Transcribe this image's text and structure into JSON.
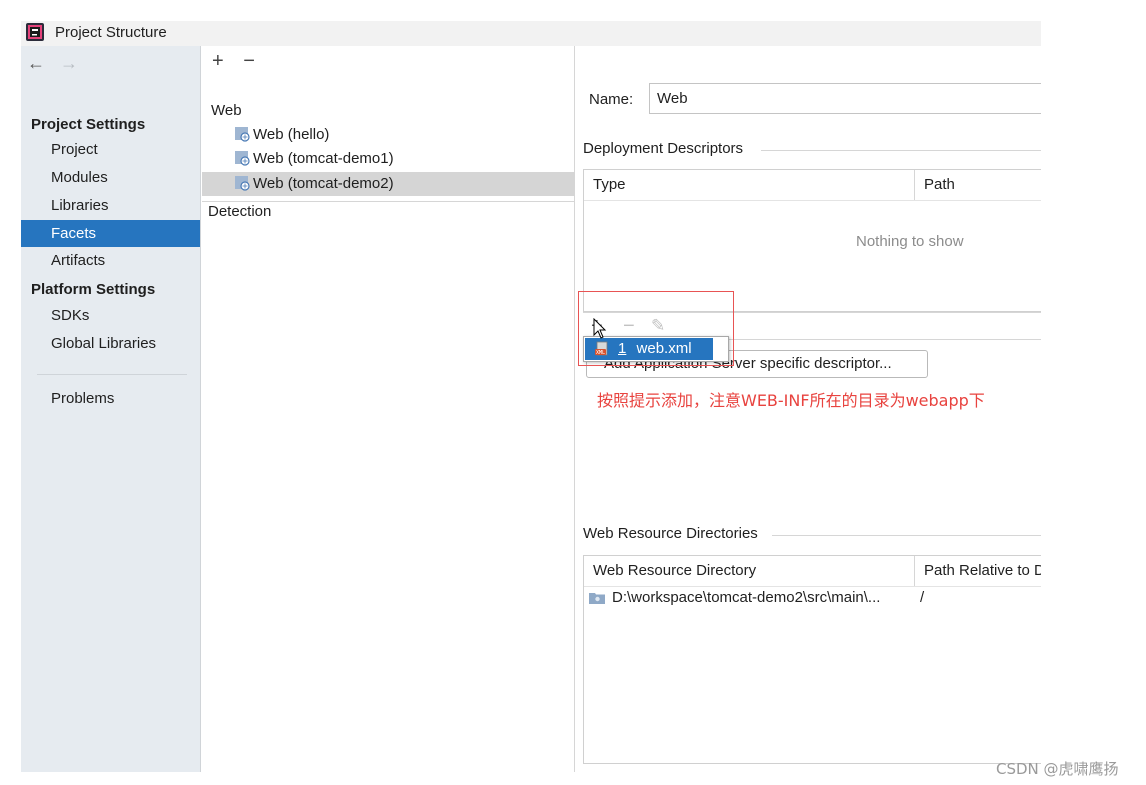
{
  "window": {
    "title": "Project Structure"
  },
  "sidebar": {
    "nav_back": "←",
    "nav_forward": "→",
    "project_settings_header": "Project Settings",
    "project_items": [
      {
        "label": "Project"
      },
      {
        "label": "Modules"
      },
      {
        "label": "Libraries"
      },
      {
        "label": "Facets",
        "selected": true
      },
      {
        "label": "Artifacts"
      }
    ],
    "platform_settings_header": "Platform Settings",
    "platform_items": [
      {
        "label": "SDKs"
      },
      {
        "label": "Global Libraries"
      }
    ],
    "problems_label": "Problems"
  },
  "facets_tree": {
    "add_label": "+",
    "remove_label": "−",
    "group_label": "Web",
    "items": [
      {
        "label": "Web (hello)"
      },
      {
        "label": "Web (tomcat-demo1)"
      },
      {
        "label": "Web (tomcat-demo2)",
        "selected": true
      }
    ],
    "detection_label": "Detection"
  },
  "facet_editor": {
    "name_label": "Name:",
    "name_value": "Web",
    "deployment": {
      "title": "Deployment Descriptors",
      "columns": [
        "Type",
        "Path"
      ],
      "empty_text": "Nothing to show",
      "toolbar": {
        "add": "+",
        "remove": "−",
        "edit": "✎"
      },
      "add_server_descriptor_button": "Add Application Server specific descriptor...",
      "popup_item": {
        "number": "1",
        "label": "web.xml"
      }
    },
    "annotation": "按照提示添加，注意WEB-INF所在的目录为webapp下",
    "web_resources": {
      "title": "Web Resource Directories",
      "columns": [
        "Web Resource Directory",
        "Path Relative to Deployment Root"
      ],
      "rows": [
        {
          "directory": "D:\\workspace\\tomcat-demo2\\src\\main\\...",
          "relative": "/"
        }
      ]
    }
  },
  "watermark": "CSDN @虎啸鹰扬",
  "colors": {
    "selection": "#2675bf",
    "sidebar_bg": "#e6ebf0",
    "annotation": "#e8433f"
  }
}
